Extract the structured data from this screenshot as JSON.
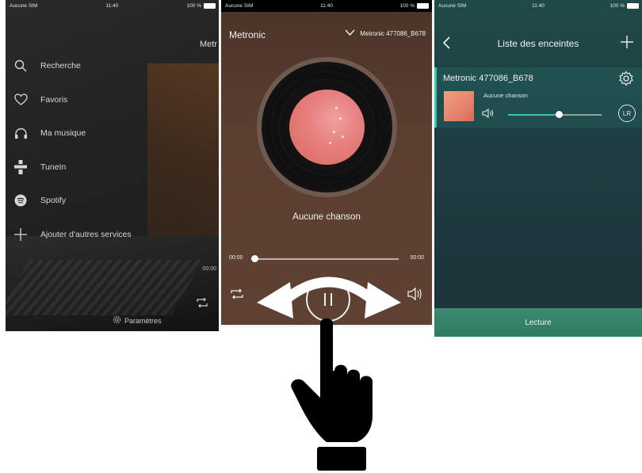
{
  "left": {
    "status": {
      "carrier": "Aucune SIM",
      "time": "11:40",
      "battery": "100 %"
    },
    "peek_title": "Metr",
    "menu": [
      {
        "label": "Recherche",
        "icon": "search-icon"
      },
      {
        "label": "Favoris",
        "icon": "heart-icon"
      },
      {
        "label": "Ma musique",
        "icon": "headphones-icon"
      },
      {
        "label": "TuneIn",
        "icon": "tunein-icon"
      },
      {
        "label": "Spotify",
        "icon": "spotify-icon"
      },
      {
        "label": "Ajouter d'autres services",
        "icon": "plus-icon"
      }
    ],
    "peek_time": "00:00",
    "settings_label": "Paramètres"
  },
  "center": {
    "status": {
      "carrier": "Aucune SIM",
      "time": "11:40",
      "battery": "100 %"
    },
    "brand": "Metronic",
    "device": "Metronic 477086_B678",
    "song": "Aucune chanson",
    "time_start": "00:00",
    "time_end": "00:00",
    "progress": 0
  },
  "right": {
    "status": {
      "carrier": "Aucune SIM",
      "time": "11:40",
      "battery": "100 %"
    },
    "title": "Liste des enceintes",
    "device_name": "Metronic 477086_B678",
    "song": "Aucune chanson",
    "volume": 0.55,
    "lr_label": "LR",
    "bottom_label": "Lecture"
  },
  "colors": {
    "accent": "#39c6a8",
    "center_bg": "#5a3e30",
    "right_bg": "#1e3d42"
  }
}
